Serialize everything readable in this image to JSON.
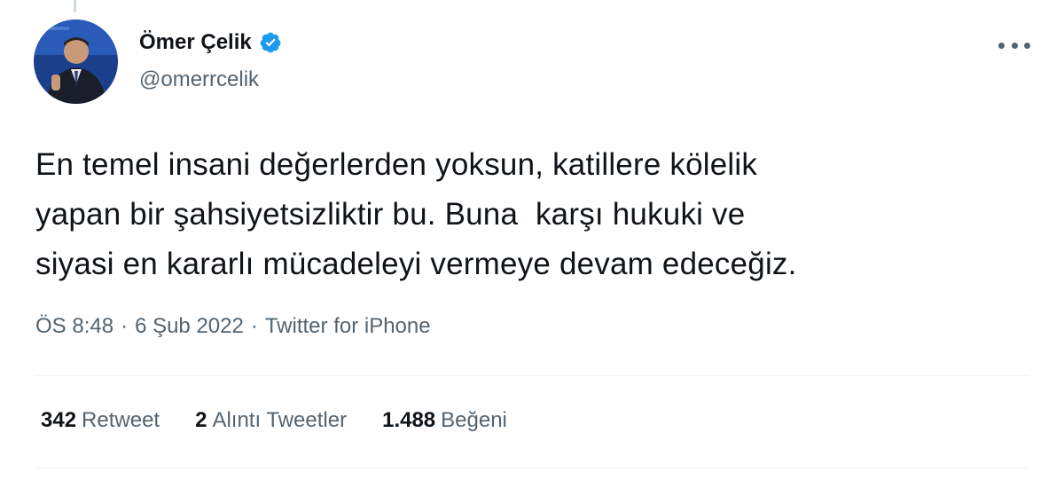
{
  "author": {
    "display_name": "Ömer Çelik",
    "handle": "@omerrcelik",
    "verified": true
  },
  "tweet": {
    "lines": [
      "En temel insani değerlerden yoksun, katillere kölelik",
      "yapan bir şahsiyetsizliktir bu. Buna  karşı hukuki ve",
      "siyasi en kararlı mücadeleyi vermeye devam edeceğiz."
    ]
  },
  "meta": {
    "time": "ÖS 8:48",
    "sep1": "·",
    "date": "6 Şub 2022",
    "sep2": "·",
    "source": "Twitter for iPhone"
  },
  "stats": [
    {
      "count": "342",
      "label": "Retweet"
    },
    {
      "count": "2",
      "label": "Alıntı Tweetler"
    },
    {
      "count": "1.488",
      "label": "Beğeni"
    }
  ],
  "icons": {
    "verified_color": "#1d9bf0",
    "more": "more-options-icon"
  }
}
